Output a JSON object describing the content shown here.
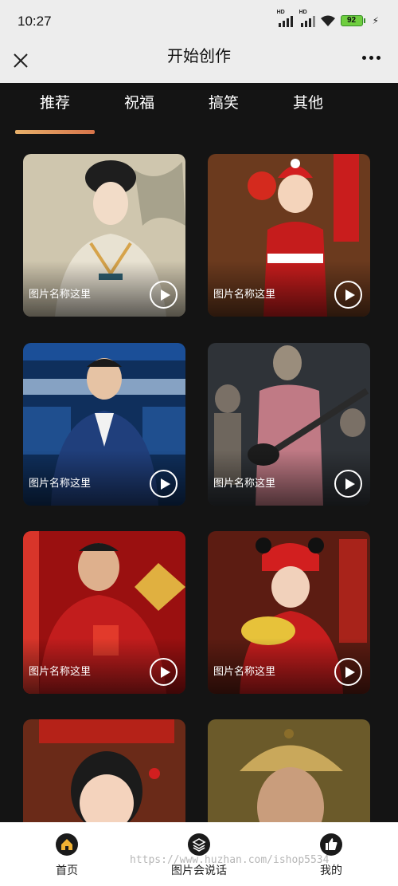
{
  "status_bar": {
    "time": "10:27",
    "battery": "92",
    "hd1": "HD",
    "hd2": "HD"
  },
  "header": {
    "title": "开始创作"
  },
  "tabs": [
    {
      "label": "推荐",
      "active": true
    },
    {
      "label": "祝福"
    },
    {
      "label": "搞笑"
    },
    {
      "label": "其他"
    }
  ],
  "cards": [
    {
      "caption": "图片名称这里",
      "image": "ancient-chinese-lady"
    },
    {
      "caption": "图片名称这里",
      "image": "child-in-red-new-year-costume"
    },
    {
      "caption": "图片名称这里",
      "image": "news-anchor-in-studio"
    },
    {
      "caption": "图片名称这里",
      "image": "terracotta-warrior-with-guitar"
    },
    {
      "caption": "图片名称这里",
      "image": "man-with-red-envelope"
    },
    {
      "caption": "图片名称这里",
      "image": "girl-with-gold-ingot"
    },
    {
      "caption": "",
      "image": "little-girl-new-year"
    },
    {
      "caption": "",
      "image": "man-in-qing-hat"
    }
  ],
  "bottom_nav": [
    {
      "label": "首页",
      "icon": "home-icon"
    },
    {
      "label": "图片会说话",
      "icon": "layers-icon"
    },
    {
      "label": "我的",
      "icon": "thumbs-up-icon"
    }
  ],
  "watermark": "https://www.huzhan.com/ishop5534",
  "colors": {
    "accent_start": "#e7b06a",
    "accent_end": "#d7744a",
    "background": "#141414"
  }
}
